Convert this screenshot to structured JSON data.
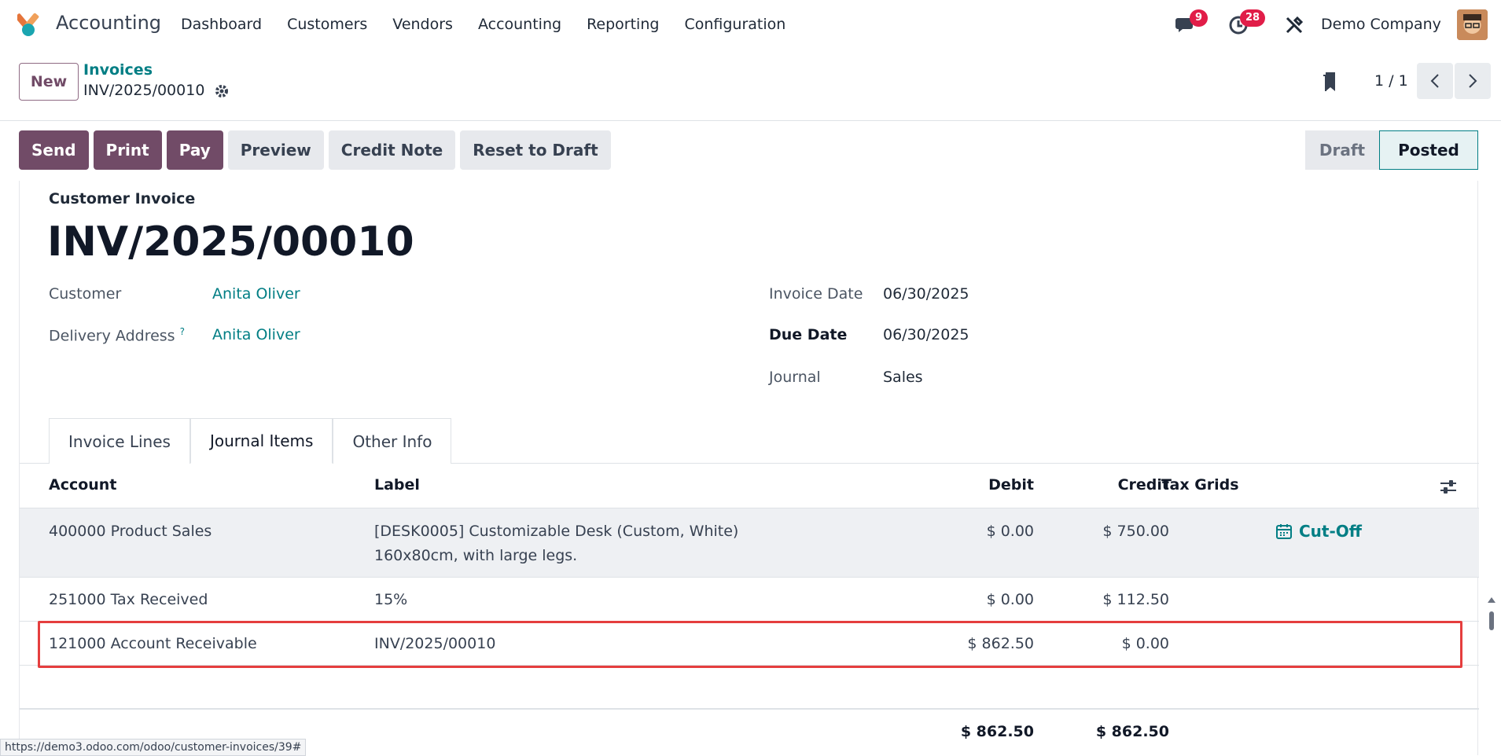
{
  "app": {
    "name": "Accounting",
    "menu": [
      "Dashboard",
      "Customers",
      "Vendors",
      "Accounting",
      "Reporting",
      "Configuration"
    ]
  },
  "systray": {
    "messages_count": "9",
    "activities_count": "28",
    "company": "Demo Company"
  },
  "control": {
    "new_label": "New",
    "breadcrumb_parent": "Invoices",
    "breadcrumb_current": "INV/2025/00010",
    "pager": "1 / 1"
  },
  "actions": {
    "send": "Send",
    "print": "Print",
    "pay": "Pay",
    "preview": "Preview",
    "credit_note": "Credit Note",
    "reset": "Reset to Draft"
  },
  "status": {
    "draft": "Draft",
    "posted": "Posted"
  },
  "form": {
    "doc_type": "Customer Invoice",
    "doc_name": "INV/2025/00010",
    "customer_label": "Customer",
    "customer": "Anita Oliver",
    "delivery_label": "Delivery Address",
    "delivery_help": "?",
    "delivery": "Anita Oliver",
    "invoice_date_label": "Invoice Date",
    "invoice_date": "06/30/2025",
    "due_date_label": "Due Date",
    "due_date": "06/30/2025",
    "journal_label": "Journal",
    "journal": "Sales"
  },
  "tabs": [
    "Invoice Lines",
    "Journal Items",
    "Other Info"
  ],
  "table": {
    "headers": {
      "account": "Account",
      "label": "Label",
      "debit": "Debit",
      "credit": "Credit",
      "tax_grids": "Tax Grids"
    },
    "rows": [
      {
        "account": "400000 Product Sales",
        "label1": "[DESK0005] Customizable Desk (Custom, White)",
        "label2": "160x80cm, with large legs.",
        "debit": "$ 0.00",
        "credit": "$ 750.00",
        "cutoff": "Cut-Off"
      },
      {
        "account": "251000 Tax Received",
        "label1": "15%",
        "debit": "$ 0.00",
        "credit": "$ 112.50"
      },
      {
        "account": "121000 Account Receivable",
        "label1": "INV/2025/00010",
        "debit": "$ 862.50",
        "credit": "$ 0.00"
      }
    ],
    "total_debit": "$ 862.50",
    "total_credit": "$ 862.50"
  },
  "status_url": "https://demo3.odoo.com/odoo/customer-invoices/39#",
  "colors": {
    "primary": "#714B67",
    "link": "#017e84",
    "highlight": "#e53e3e"
  }
}
